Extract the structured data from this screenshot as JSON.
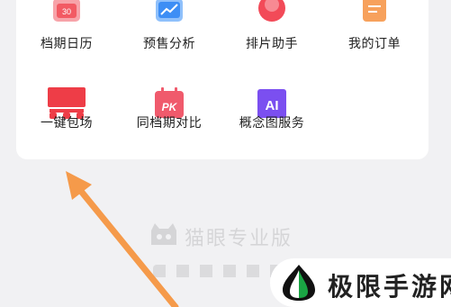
{
  "toolbox": {
    "items": [
      {
        "label": "档期日历",
        "icon": "calendar-30-icon",
        "color": "#f25a63"
      },
      {
        "label": "预售分析",
        "icon": "trend-chart-icon",
        "color": "#3d8ef5"
      },
      {
        "label": "排片助手",
        "icon": "assistant-circle-icon",
        "color": "#f24a58"
      },
      {
        "label": "我的订单",
        "icon": "order-list-icon",
        "color": "#f7a15c"
      },
      {
        "label": "一键包场",
        "icon": "theater-screen-icon",
        "color": "#ee3d47"
      },
      {
        "label": "同档期对比",
        "icon": "pk-calendar-icon",
        "color": "#f05a6c"
      },
      {
        "label": "概念图服务",
        "icon": "ai-icon",
        "color": "#7b4ff0"
      }
    ],
    "calendar_day": "30",
    "pk_text": "PK",
    "ai_text": "AI"
  },
  "watermark": {
    "text": "猫眼专业版"
  },
  "site_badge": {
    "text": "极限手游网",
    "accent": "#1aa544"
  },
  "annotation": {
    "arrow_color": "#f59a4a"
  }
}
